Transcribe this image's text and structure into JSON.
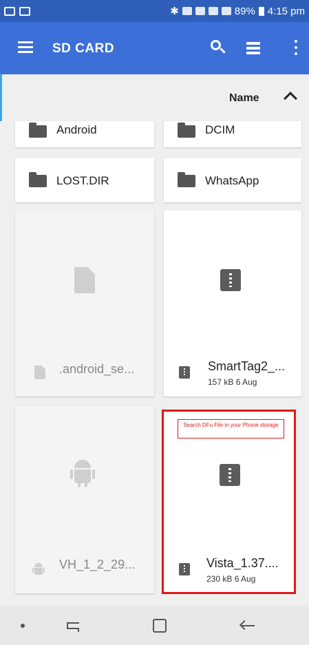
{
  "status_bar": {
    "battery": "89%",
    "time": "4:15 pm"
  },
  "app_bar": {
    "title": "SD CARD",
    "icons": [
      "menu-icon",
      "search-icon",
      "list-view-icon",
      "more-vert-icon"
    ]
  },
  "sort": {
    "label": "Name",
    "direction_icon": "chevron-up-icon"
  },
  "folders": [
    {
      "name": "Android"
    },
    {
      "name": "DCIM"
    },
    {
      "name": "LOST.DIR"
    },
    {
      "name": "WhatsApp"
    }
  ],
  "files": [
    {
      "name": ".android_se...",
      "meta": "",
      "type": "document",
      "dimmed": true
    },
    {
      "name": "SmartTag2_...",
      "meta": "157 kB 6 Aug",
      "type": "zip",
      "dimmed": false
    },
    {
      "name": "VH_1_2_29...",
      "meta": "",
      "type": "apk",
      "dimmed": true
    },
    {
      "name": "Vista_1.37....",
      "meta": "230 kB 6 Aug",
      "type": "zip",
      "dimmed": false
    }
  ],
  "annotation": {
    "note": "Search DFu File in your Phone storage",
    "color": "#e01818"
  },
  "colors": {
    "status_bar": "#2f5fb8",
    "app_bar": "#3d6fd8",
    "background": "#efefef"
  },
  "nav_bar": {
    "icons": [
      "dot-icon",
      "recent-apps-icon",
      "home-icon",
      "back-icon"
    ]
  }
}
